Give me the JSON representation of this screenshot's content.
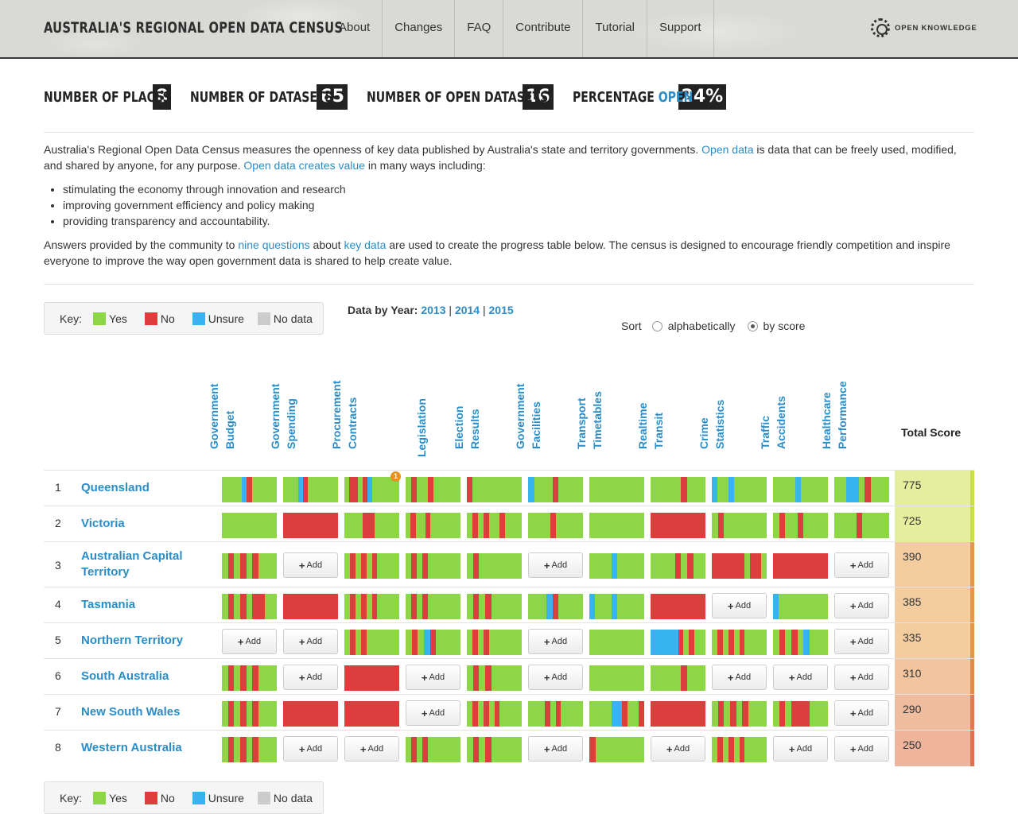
{
  "header": {
    "title": "AUSTRALIA'S REGIONAL OPEN DATA CENSUS",
    "nav": [
      "About",
      "Changes",
      "FAQ",
      "Contribute",
      "Tutorial",
      "Support"
    ],
    "partner": "OPEN KNOWLEDGE"
  },
  "stats": [
    {
      "label": "NUMBER OF PLACES",
      "value": "8"
    },
    {
      "label": "NUMBER OF DATASETS",
      "value": "65"
    },
    {
      "label": "NUMBER OF OPEN DATASETS",
      "value": "16"
    },
    {
      "label_prefix": "PERCENTAGE ",
      "label_accent": "OPEN",
      "value": "24%"
    }
  ],
  "intro": {
    "p1_a": "Australia's Regional Open Data Census measures the openness of key data published by Australia's state and territory governments. ",
    "p1_link1": "Open data",
    "p1_b": " is data that can be freely used, modified, and shared by anyone, for any purpose. ",
    "p1_link2": "Open data creates value",
    "p1_c": " in many ways including:",
    "bullets": [
      "stimulating the economy through innovation and research",
      "improving government efficiency and policy making",
      "providing transparency and accountability."
    ],
    "p2_a": "Answers provided by the community to ",
    "p2_link1": "nine questions",
    "p2_b": " about ",
    "p2_link2": "key data",
    "p2_c": " are used to create the progress table below. The census is designed to encourage friendly competition and inspire everyone to improve the way open government data is shared to help create value."
  },
  "key": {
    "label": "Key:",
    "yes": "Yes",
    "no": "No",
    "unsure": "Unsure",
    "nodata": "No data"
  },
  "colors": {
    "yes": "#8dd645",
    "no": "#dc3d3d",
    "unsure": "#36b4ef",
    "nodata": "#cccccc",
    "link": "#2a8dc8"
  },
  "years": {
    "label": "Data by Year:",
    "y2013": "2013",
    "y2014": "2014",
    "y2015": "2015",
    "sep": "|"
  },
  "sort": {
    "label": "Sort",
    "alpha": "alphabetically",
    "score": "by score",
    "selected": "by score"
  },
  "datasets": [
    [
      "Government",
      "Budget"
    ],
    [
      "Government",
      "Spending"
    ],
    [
      "Procurement",
      "Contracts"
    ],
    [
      "Legislation",
      ""
    ],
    [
      "Election",
      "Results"
    ],
    [
      "Government",
      "Facilities"
    ],
    [
      "Transport",
      "Timetables"
    ],
    [
      "Realtime",
      "Transit"
    ],
    [
      "Crime",
      "Statistics"
    ],
    [
      "Traffic",
      "Accidents"
    ],
    [
      "Healthcare",
      "Performance"
    ]
  ],
  "total_label": "Total Score",
  "add_label": "Add",
  "badge": "1",
  "rows": [
    {
      "rank": "1",
      "place": "Queensland",
      "score": "775",
      "cells": [
        "ggggynggggg",
        "gggyngggggg",
        "gnngnygggggg",
        "gnggnggggg",
        "nggggggggg",
        "ygggngggg",
        "gggggggg",
        "gggggnggg",
        "yggygggggg",
        "ggggyggggg",
        "ggyygnggg"
      ]
    },
    {
      "rank": "2",
      "place": "Victoria",
      "score": "725",
      "cells": [
        "gggggggggg",
        "nnnnnnnnnn",
        "gggnngggg",
        "gnggngggggg",
        "gngnggnggg",
        "ggggnggggg",
        "gggggggggg",
        "nnnnnnnnnn",
        "gnggggggg",
        "gnggngggg",
        "ggggnggggg"
      ]
    },
    {
      "rank": "3",
      "place": "Australian Capital Territory",
      "score": "390",
      "cells": [
        "gngngnggg",
        "ADD",
        "gngngngggg",
        "gngngggggg",
        "gnggggggg",
        "ADD",
        "ggggyggggg",
        "ggggngngg",
        "nnnnnngnng",
        "nnnnnnnnnn",
        "ADD"
      ]
    },
    {
      "rank": "4",
      "place": "Tasmania",
      "score": "385",
      "cells": [
        "gngngnngg",
        "nnnnnnnnnn",
        "gngngngggg",
        "gngngggggg",
        "gngnggggg",
        "gggyngggg",
        "ygggyggggg",
        "nnnnnnnnnn",
        "ADD",
        "yggggggggg",
        "ADD"
      ]
    },
    {
      "rank": "5",
      "place": "Northern Territory",
      "score": "335",
      "cells": [
        "ADD",
        "ADD",
        "gngngggggg",
        "gngyngggg",
        "gngngggggg",
        "ADD",
        "gggggggggg",
        "yyyyyngngg",
        "gngngngggg",
        "gngngyggg",
        "ADD"
      ]
    },
    {
      "rank": "6",
      "place": "South Australia",
      "score": "310",
      "cells": [
        "gngngnggg",
        "ADD",
        "nnnnnnnnnn",
        "ADD",
        "gngnggggg",
        "ADD",
        "gggggggggg",
        "gggggnggg",
        "ADD",
        "ADD",
        "ADD"
      ]
    },
    {
      "rank": "7",
      "place": "New South Wales",
      "score": "290",
      "cells": [
        "gngngnggg",
        "nnnnnnnnnn",
        "nnnnnnnnnn",
        "ADD",
        "gngngngggg",
        "gggngngggg",
        "ggggyynggn",
        "nnnnnnnnnn",
        "gngngnggg",
        "gngnnnggg",
        "ADD"
      ]
    },
    {
      "rank": "8",
      "place": "Western Australia",
      "score": "250",
      "cells": [
        "gngngnggg",
        "ADD",
        "ADD",
        "gngngggggg",
        "gngnggggg",
        "ADD",
        "ngggggggg",
        "ADD",
        "gngngngggg",
        "ADD",
        "ADD"
      ]
    }
  ]
}
